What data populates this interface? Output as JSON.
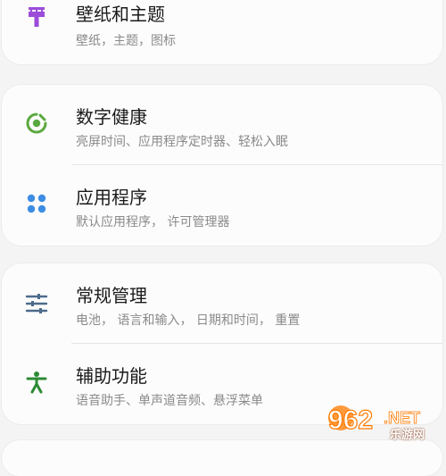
{
  "settings": {
    "wallpaper": {
      "title": "壁纸和主题",
      "subtitle": "壁纸，主题，图标",
      "icon": "paintbrush-icon",
      "color": "#9b4cd8"
    },
    "digital_wellbeing": {
      "title": "数字健康",
      "subtitle": "亮屏时间、应用程序定时器、轻松入眠",
      "icon": "wellbeing-icon",
      "color": "#5aa83f"
    },
    "apps": {
      "title": "应用程序",
      "subtitle": "默认应用程序， 许可管理器",
      "icon": "apps-grid-icon",
      "color": "#3d8ee3"
    },
    "general_management": {
      "title": "常规管理",
      "subtitle": "电池， 语言和输入， 日期和时间， 重置",
      "icon": "sliders-icon",
      "color": "#4d6b8a"
    },
    "accessibility": {
      "title": "辅助功能",
      "subtitle": "语音助手、单声道音频、悬浮菜单",
      "icon": "accessibility-icon",
      "color": "#2c8a33"
    }
  },
  "watermark": {
    "logo": "962.NET",
    "site": "乐游网"
  }
}
